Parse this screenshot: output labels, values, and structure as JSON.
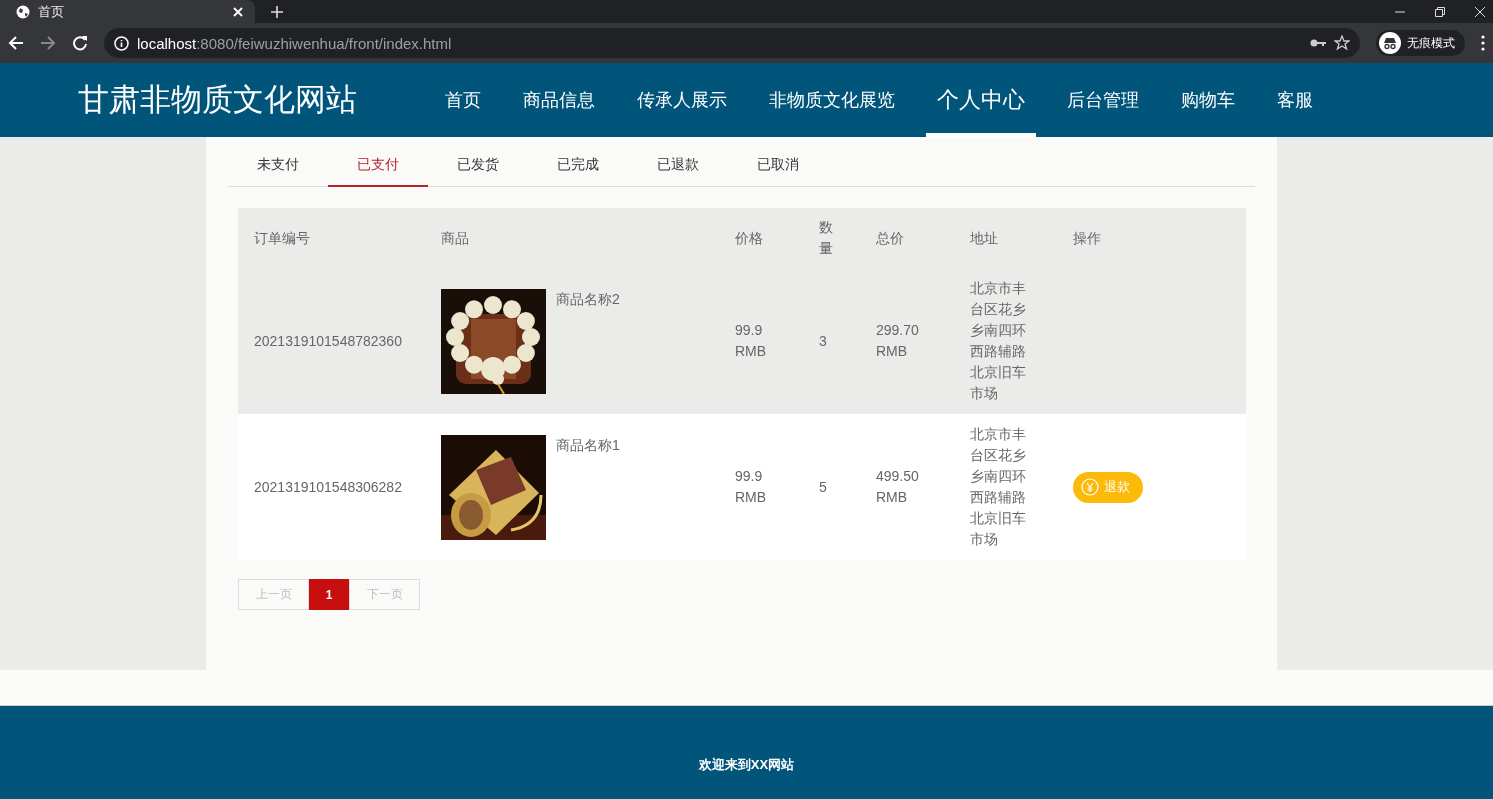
{
  "browser": {
    "tab": {
      "title": "首页"
    },
    "url_host": "localhost",
    "url_path": ":8080/feiwuzhiwenhua/front/index.html",
    "profile": "无痕模式"
  },
  "header": {
    "site_title": "甘肃非物质文化网站",
    "nav": [
      {
        "label": "首页",
        "selected": false
      },
      {
        "label": "商品信息",
        "selected": false
      },
      {
        "label": "传承人展示",
        "selected": false
      },
      {
        "label": "非物质文化展览",
        "selected": false
      },
      {
        "label": "个人中心",
        "selected": true
      },
      {
        "label": "后台管理",
        "selected": false
      },
      {
        "label": "购物车",
        "selected": false
      },
      {
        "label": "客服",
        "selected": false
      }
    ]
  },
  "order_tabs": [
    {
      "label": "未支付",
      "selected": false
    },
    {
      "label": "已支付",
      "selected": true
    },
    {
      "label": "已发货",
      "selected": false
    },
    {
      "label": "已完成",
      "selected": false
    },
    {
      "label": "已退款",
      "selected": false
    },
    {
      "label": "已取消",
      "selected": false
    }
  ],
  "table": {
    "columns": [
      "订单编号",
      "商品",
      "价格",
      "数量",
      "总价",
      "地址",
      "操作"
    ],
    "rows": [
      {
        "order_no": "2021319101548782360",
        "product": "商品名称2",
        "price": "99.9 RMB",
        "quantity": "3",
        "total": "299.70 RMB",
        "address": "北京市丰台区花乡乡南四环西路辅路北京旧车市场",
        "highlighted": true
      },
      {
        "order_no": "2021319101548306282",
        "product": "商品名称1",
        "price": "99.9 RMB",
        "quantity": "5",
        "total": "499.50 RMB",
        "address": "北京市丰台区花乡乡南四环西路辅路北京旧车市场",
        "highlighted": false,
        "action": "退款"
      }
    ]
  },
  "pagination": {
    "prev": "上一页",
    "pages": [
      {
        "label": "1",
        "selected": true
      }
    ],
    "next": "下一页"
  },
  "footer": {
    "text": "欢迎来到XX网站"
  }
}
